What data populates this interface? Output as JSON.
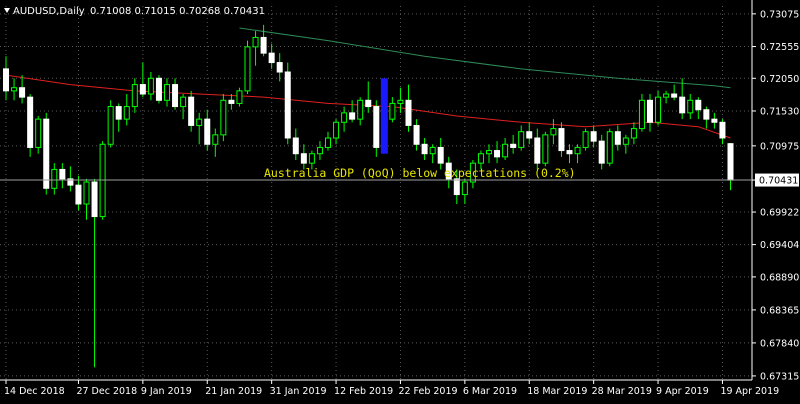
{
  "header": {
    "symbol_label": "AUDUSD,Daily",
    "ohlc": "0.71008 0.71015 0.70268 0.70431"
  },
  "chart_data": {
    "type": "candlestick",
    "symbol": "AUDUSD",
    "timeframe": "Daily",
    "ylim": [
      0.6725,
      0.732
    ],
    "yticks": [
      "0.73075",
      "0.72555",
      "0.72050",
      "0.71530",
      "0.70975",
      "0.70431",
      "0.69922",
      "0.69404",
      "0.68890",
      "0.68365",
      "0.67840",
      "0.67315"
    ],
    "current_price": "0.70431",
    "xticks": [
      {
        "label": "14 Dec 2018",
        "index": 0
      },
      {
        "label": "27 Dec 2018",
        "index": 9
      },
      {
        "label": "9 Jan 2019",
        "index": 17
      },
      {
        "label": "21 Jan 2019",
        "index": 25
      },
      {
        "label": "31 Jan 2019",
        "index": 33
      },
      {
        "label": "12 Feb 2019",
        "index": 41
      },
      {
        "label": "22 Feb 2019",
        "index": 49
      },
      {
        "label": "6 Mar 2019",
        "index": 57
      },
      {
        "label": "18 Mar 2019",
        "index": 65
      },
      {
        "label": "28 Mar 2019",
        "index": 73
      },
      {
        "label": "9 Apr 2019",
        "index": 81
      },
      {
        "label": "19 Apr 2019",
        "index": 89
      }
    ],
    "candles": [
      [
        0.722,
        0.724,
        0.717,
        0.7185
      ],
      [
        0.7185,
        0.7205,
        0.717,
        0.719
      ],
      [
        0.719,
        0.721,
        0.7165,
        0.7175
      ],
      [
        0.7175,
        0.718,
        0.708,
        0.7095
      ],
      [
        0.7095,
        0.7145,
        0.7085,
        0.714
      ],
      [
        0.714,
        0.715,
        0.702,
        0.703
      ],
      [
        0.703,
        0.707,
        0.702,
        0.706
      ],
      [
        0.706,
        0.707,
        0.703,
        0.7045
      ],
      [
        0.7045,
        0.7065,
        0.7025,
        0.7035
      ],
      [
        0.7035,
        0.705,
        0.6995,
        0.7005
      ],
      [
        0.7005,
        0.7045,
        0.698,
        0.704
      ],
      [
        0.704,
        0.7045,
        0.6745,
        0.6985
      ],
      [
        0.6985,
        0.7105,
        0.698,
        0.71
      ],
      [
        0.71,
        0.717,
        0.7095,
        0.716
      ],
      [
        0.716,
        0.7165,
        0.712,
        0.714
      ],
      [
        0.714,
        0.718,
        0.713,
        0.716
      ],
      [
        0.716,
        0.7205,
        0.715,
        0.7195
      ],
      [
        0.7195,
        0.723,
        0.7175,
        0.718
      ],
      [
        0.718,
        0.7215,
        0.717,
        0.7205
      ],
      [
        0.7205,
        0.721,
        0.7165,
        0.717
      ],
      [
        0.717,
        0.7205,
        0.716,
        0.7195
      ],
      [
        0.7195,
        0.7205,
        0.7155,
        0.716
      ],
      [
        0.716,
        0.718,
        0.714,
        0.7175
      ],
      [
        0.7175,
        0.7185,
        0.712,
        0.713
      ],
      [
        0.713,
        0.715,
        0.71,
        0.714
      ],
      [
        0.714,
        0.7155,
        0.709,
        0.71
      ],
      [
        0.71,
        0.7125,
        0.708,
        0.7115
      ],
      [
        0.7115,
        0.718,
        0.7105,
        0.717
      ],
      [
        0.717,
        0.718,
        0.7155,
        0.7165
      ],
      [
        0.7165,
        0.719,
        0.716,
        0.7185
      ],
      [
        0.7185,
        0.7265,
        0.718,
        0.7255
      ],
      [
        0.7255,
        0.728,
        0.7225,
        0.727
      ],
      [
        0.727,
        0.729,
        0.724,
        0.7245
      ],
      [
        0.7245,
        0.726,
        0.722,
        0.723
      ],
      [
        0.723,
        0.7245,
        0.72,
        0.7215
      ],
      [
        0.7215,
        0.723,
        0.71,
        0.711
      ],
      [
        0.711,
        0.7125,
        0.7075,
        0.7085
      ],
      [
        0.7085,
        0.71,
        0.706,
        0.707
      ],
      [
        0.707,
        0.709,
        0.706,
        0.7085
      ],
      [
        0.7085,
        0.7105,
        0.7075,
        0.7095
      ],
      [
        0.7095,
        0.712,
        0.709,
        0.711
      ],
      [
        0.711,
        0.714,
        0.71,
        0.7135
      ],
      [
        0.7135,
        0.716,
        0.712,
        0.715
      ],
      [
        0.715,
        0.717,
        0.7135,
        0.714
      ],
      [
        0.714,
        0.7175,
        0.713,
        0.717
      ],
      [
        0.717,
        0.72,
        0.715,
        0.716
      ],
      [
        0.716,
        0.717,
        0.708,
        0.7095
      ],
      [
        0.7095,
        0.7145,
        0.709,
        0.714
      ],
      [
        0.714,
        0.7175,
        0.7135,
        0.7165
      ],
      [
        0.7165,
        0.719,
        0.715,
        0.717
      ],
      [
        0.717,
        0.7195,
        0.712,
        0.713
      ],
      [
        0.713,
        0.714,
        0.709,
        0.71
      ],
      [
        0.71,
        0.711,
        0.7075,
        0.7085
      ],
      [
        0.7085,
        0.71,
        0.707,
        0.7095
      ],
      [
        0.7095,
        0.711,
        0.706,
        0.707
      ],
      [
        0.707,
        0.708,
        0.703,
        0.7045
      ],
      [
        0.7045,
        0.706,
        0.7005,
        0.702
      ],
      [
        0.702,
        0.7045,
        0.7005,
        0.704
      ],
      [
        0.704,
        0.7075,
        0.703,
        0.707
      ],
      [
        0.707,
        0.709,
        0.706,
        0.7085
      ],
      [
        0.7085,
        0.71,
        0.707,
        0.709
      ],
      [
        0.709,
        0.7105,
        0.707,
        0.708
      ],
      [
        0.708,
        0.711,
        0.7075,
        0.71
      ],
      [
        0.71,
        0.7115,
        0.7085,
        0.7095
      ],
      [
        0.7095,
        0.713,
        0.709,
        0.712
      ],
      [
        0.712,
        0.7135,
        0.71,
        0.711
      ],
      [
        0.711,
        0.7125,
        0.706,
        0.707
      ],
      [
        0.707,
        0.712,
        0.7065,
        0.7115
      ],
      [
        0.7115,
        0.714,
        0.71,
        0.7125
      ],
      [
        0.7125,
        0.7135,
        0.708,
        0.709
      ],
      [
        0.709,
        0.71,
        0.707,
        0.7085
      ],
      [
        0.7085,
        0.71,
        0.707,
        0.7095
      ],
      [
        0.7095,
        0.7125,
        0.709,
        0.712
      ],
      [
        0.712,
        0.713,
        0.7095,
        0.7105
      ],
      [
        0.7105,
        0.7115,
        0.706,
        0.707
      ],
      [
        0.707,
        0.7125,
        0.7065,
        0.712
      ],
      [
        0.712,
        0.713,
        0.709,
        0.71
      ],
      [
        0.71,
        0.7115,
        0.7085,
        0.711
      ],
      [
        0.711,
        0.7135,
        0.71,
        0.7125
      ],
      [
        0.7125,
        0.718,
        0.712,
        0.717
      ],
      [
        0.717,
        0.718,
        0.712,
        0.7135
      ],
      [
        0.7135,
        0.7185,
        0.713,
        0.7175
      ],
      [
        0.7175,
        0.7185,
        0.7165,
        0.718
      ],
      [
        0.718,
        0.7195,
        0.717,
        0.7175
      ],
      [
        0.7175,
        0.7205,
        0.714,
        0.715
      ],
      [
        0.715,
        0.718,
        0.714,
        0.717
      ],
      [
        0.717,
        0.7175,
        0.714,
        0.7155
      ],
      [
        0.7155,
        0.716,
        0.7125,
        0.714
      ],
      [
        0.714,
        0.715,
        0.7125,
        0.7135
      ],
      [
        0.7135,
        0.714,
        0.71,
        0.711
      ],
      [
        0.7101,
        0.7102,
        0.7027,
        0.7043
      ]
    ],
    "moving_averages": [
      {
        "color": "#2e8b57",
        "points": [
          [
            29,
            0.7285
          ],
          [
            40,
            0.7265
          ],
          [
            52,
            0.724
          ],
          [
            64,
            0.722
          ],
          [
            76,
            0.7205
          ],
          [
            88,
            0.7193
          ],
          [
            90,
            0.719
          ]
        ]
      },
      {
        "color": "#e02020",
        "points": [
          [
            0,
            0.721
          ],
          [
            8,
            0.7195
          ],
          [
            16,
            0.7185
          ],
          [
            24,
            0.718
          ],
          [
            32,
            0.7175
          ],
          [
            40,
            0.7165
          ],
          [
            48,
            0.716
          ],
          [
            56,
            0.7145
          ],
          [
            64,
            0.7135
          ],
          [
            72,
            0.7128
          ],
          [
            80,
            0.7135
          ],
          [
            86,
            0.7128
          ],
          [
            90,
            0.711
          ]
        ]
      }
    ],
    "marker": {
      "index": 47,
      "top": 0.7205,
      "bottom": 0.7085,
      "color": "#1a1aff"
    },
    "annotation": {
      "text": "Australia GDP (QoQ) below expectations (0.2%)",
      "color": "#e6e600",
      "index": 41,
      "price": 0.7045
    }
  }
}
